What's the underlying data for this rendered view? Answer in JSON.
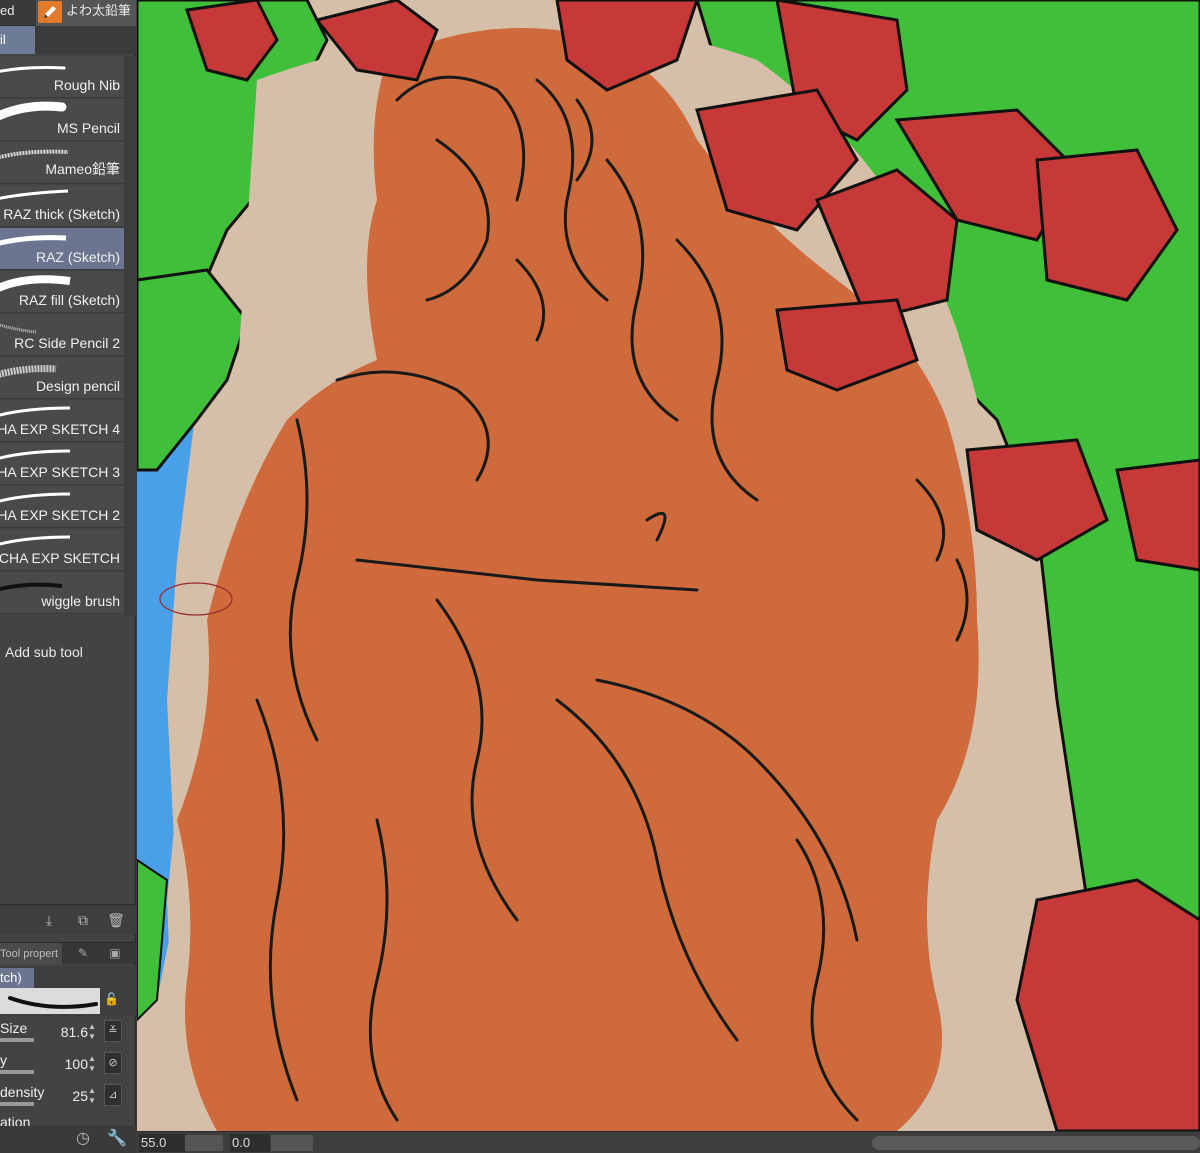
{
  "tool_tabs": {
    "left_label": "ed",
    "right_label": "よわ太鉛筆"
  },
  "group_tab": "il",
  "sub_tools": [
    {
      "label": "Rough Nib",
      "selected": false
    },
    {
      "label": "MS Pencil",
      "selected": false
    },
    {
      "label": "Mameo鉛筆",
      "selected": false
    },
    {
      "label": "RAZ thick (Sketch)",
      "selected": false
    },
    {
      "label": "RAZ (Sketch)",
      "selected": true
    },
    {
      "label": "RAZ fill (Sketch)",
      "selected": false
    },
    {
      "label": "RC Side Pencil 2",
      "selected": false
    },
    {
      "label": "Design pencil",
      "selected": false
    },
    {
      "label": "HA EXP SKETCH 4",
      "selected": false
    },
    {
      "label": "HA EXP SKETCH 3",
      "selected": false
    },
    {
      "label": "HA EXP SKETCH 2",
      "selected": false
    },
    {
      "label": "CHA EXP SKETCH",
      "selected": false
    },
    {
      "label": "wiggle brush",
      "selected": false
    }
  ],
  "add_sub_tool_label": "Add sub tool",
  "tool_property": {
    "tab_label": "Tool propert",
    "preview_label": "tch)",
    "rows": [
      {
        "label": "Size",
        "value": "81.6"
      },
      {
        "label": "y",
        "value": "100"
      },
      {
        "label": "density",
        "value": "25"
      },
      {
        "label": "ation",
        "value": ""
      }
    ]
  },
  "status_bar": {
    "zoom": "55.0",
    "angle": "0.0"
  },
  "colors": {
    "panel_bg": "#434343",
    "selected_bg": "#6b7590",
    "accent_orange": "#e27a2c",
    "canvas_skin": "#cf6a3c",
    "canvas_green": "#3fbf3a",
    "canvas_red": "#c73838",
    "canvas_blue": "#4aa0e8",
    "canvas_bg": "#d6bfa9"
  }
}
